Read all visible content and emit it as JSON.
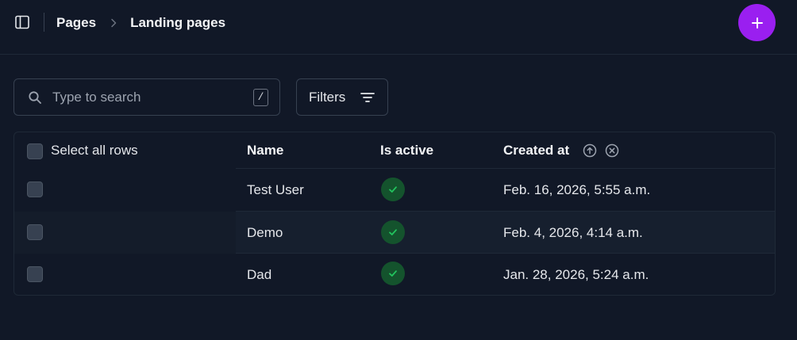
{
  "header": {
    "breadcrumb": [
      "Pages",
      "Landing pages"
    ]
  },
  "search": {
    "placeholder": "Type to search",
    "value": "",
    "shortcut": "/"
  },
  "filters": {
    "label": "Filters"
  },
  "table": {
    "select_all_label": "Select all rows",
    "columns": [
      "Name",
      "Is active",
      "Created at"
    ],
    "rows": [
      {
        "name": "Test User",
        "is_active": true,
        "created_at": "Feb. 16, 2026, 5:55 a.m."
      },
      {
        "name": "Demo",
        "is_active": true,
        "created_at": "Feb. 4, 2026, 4:14 a.m."
      },
      {
        "name": "Dad",
        "is_active": true,
        "created_at": "Jan. 28, 2026, 5:24 a.m."
      }
    ]
  },
  "colors": {
    "background": "#111827",
    "accent": "#9a1ff0",
    "success_bg": "#14532d",
    "success_check": "#22c55e"
  },
  "icons": {
    "sidebar_toggle": "sidebar-toggle-icon",
    "chevron": "chevron-right-icon",
    "add": "plus-icon",
    "search": "search-icon",
    "filter": "filter-icon",
    "sort": "sort-ascending-icon",
    "clear_sort": "clear-sort-icon",
    "active": "check-circle-icon"
  }
}
